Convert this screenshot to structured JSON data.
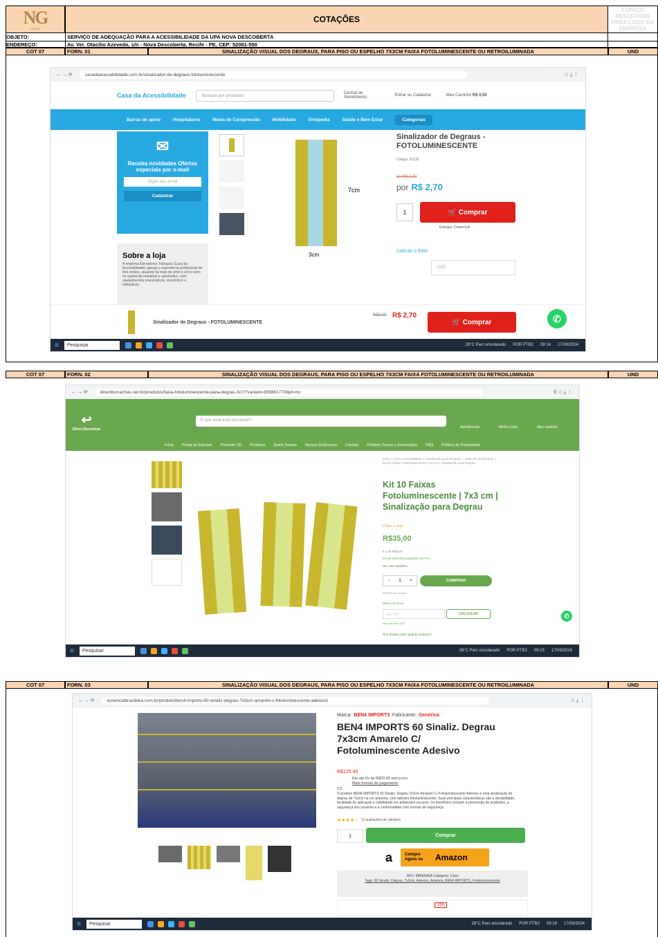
{
  "header": {
    "logo": "NG",
    "logo_sub": "FARMA",
    "title": "COTAÇÕES",
    "reserved": "ESPAÇO RESERVADO PARA LOGO DA EMPRESA"
  },
  "meta": {
    "objeto_label": "OBJETO:",
    "objeto": "SERVIÇO DE ADEQUAÇÃO PARA A ACESSIBILIDADE DA UPA NOVA DESCOBERTA",
    "endereco_label": "ENDEREÇO:",
    "endereco": "Av. Ver. Otacílio Azevedo, s/n - Nova Descoberta, Recife - PE, CEP: 52081-550"
  },
  "quotes": [
    {
      "cot": "COT 07",
      "forn": "FORN. 01",
      "item": "SINALIZAÇÃO VISUAL DOS DEGRAUS, PARA PISO OU ESPELHO 7X3CM FAIXA FOTOLUMINESCENTE OU RETROILUMINADA",
      "und": "UND"
    },
    {
      "cot": "COT 07",
      "forn": "FORN. 02",
      "item": "SINALIZAÇÃO VISUAL DOS DEGRAUS, PARA PISO OU ESPELHO 7X3CM FAIXA FOTOLUMINESCENTE OU RETROILUMINADA",
      "und": "UND"
    },
    {
      "cot": "COT 07",
      "forn": "FORN. 03",
      "item": "SINALIZAÇÃO VISUAL DOS DEGRAUS, PARA PISO OU ESPELHO 7X3CM FAIXA FOTOLUMINESCENTE OU RETROILUMINADA",
      "und": "UND"
    }
  ],
  "shot1": {
    "url": "casadaacessibilidade.com.br/sinalizador-de-degraus-fotoluminescente",
    "store": "Casa da Acessibilidade",
    "search": "Busque por produtos",
    "central": "Central de Atendimento",
    "entrar": "Entrar ou Cadastrar",
    "cart": "Meu Carrinho",
    "cart_val": "R$ 0,00",
    "nav": [
      "Barras de apoio",
      "Hospitalares",
      "Meias de Compressão",
      "Mobilidade",
      "Ortopedia",
      "Saúde e Bem Estar",
      "Categorias"
    ],
    "news_title": "Receba novidades Ofertas especiais por e-mail",
    "email_ph": "Digite seu email",
    "cadastrar": "Cadastrar",
    "sobre": "Sobre a loja",
    "sobre_text": "A empresa Elevadores Triângulo (Casa da Acessibilidade) agrega a experiência profissional de três irmãos, atuando há mais de vinte e cinco anos no segmento industrial e automotivo, com equipamentos pneumáticos, mecânicos e hidráulicos.",
    "dim_h": "7cm",
    "dim_w": "3cm",
    "product": "Sinalizador de Degraus - FOTOLUMINESCENTE",
    "codigo": "Código: 62135",
    "old": "de R$ 3,00",
    "por": "por",
    "price": "R$ 2,70",
    "qty": "1",
    "comprar": "Comprar",
    "estoque": "Estoque: Disponível",
    "frete": "Calcule o frete",
    "cep": "CEP",
    "bar_product": "Sinalizador de Degraus - FOTOLUMINESCENTE",
    "bar_old": "R$3,00",
    "bar_price": "R$ 2,70",
    "taskbar_search": "Pesquisar",
    "weather": "28°C Parc ensolarado",
    "lang": "POR PTB2",
    "time": "09:14",
    "date": "17/09/2024"
  },
  "shot2": {
    "url": "directborrachas.net.br/produtos/faixa-fotoluminescente-para-degrau-3x7/?variant=3558617708pf=mc",
    "search": "O que você está buscando?",
    "brand": "Direct Borrachas",
    "nav": [
      "Início",
      "Ponta de Estoque",
      "Premium 3D",
      "Produtos",
      "Quem Somos",
      "Nossos Endereços",
      "Contato",
      "Pedidos Trocas e Devoluções",
      "FAQ",
      "Política de Privacidade"
    ],
    "top_links": [
      "Atendimento",
      "Minha conta",
      "Meu carrinho"
    ],
    "breadcrumb": "Início > Linha Acessibilidade > Sinalização para Escadas > Faixa de Sinalização > Kit 10 Faixas Fotoluminescente | 7x3 cm | Sinalização para Degrau",
    "title": "Kit 10 Faixas Fotoluminescente | 7x3 cm | Sinalização para Degrau",
    "note": "Clique e veja!",
    "price": "R$35,00",
    "install": "8 x de R$5,09",
    "desconto": "5% de desconto pagando com Pix",
    "detalhes": "Ver mais detalhes",
    "qty": "1",
    "comprar": "COMPRAR",
    "estoque": "999999 em estoque",
    "frete": "Meios de envio",
    "cep_ph": "Seu CEP",
    "calcular": "CALCULAR",
    "naosei": "Não sei meu CEP",
    "duvida": "Tem dúvida sobre quanto comprar?",
    "taskbar_search": "Pesquisar",
    "weather": "28°C Parc ensolarado",
    "lang": "POR PTB2",
    "time": "09:15",
    "date": "17/09/2024"
  },
  "shot3": {
    "url": "essenciabrasileira.com.br/produto/ben4-imports-60-sinaliz-degrau-7x3cm-amarelo-c-fotoluminescente-adesivo/",
    "marca_label": "Marca:",
    "marca": "BEN4 IMPORTS",
    "fab_label": "Fabricante:",
    "fab": "Genérica",
    "title": "BEN4 IMPORTS 60 Sinaliz. Degrau 7x3cm Amarelo C/ Fotoluminescente Adesivo",
    "price": "R$125.40",
    "install": "Em até 6x de R$20.90 sem juros",
    "formas": "Mais formas de pagamento",
    "desc": "O produto BEN4 IMPORTS 60 Sinaliz. Degrau 7x3cm Amarelo C/ Fotoluminescente Adesivo é uma sinalização de degrau de 7x3cm na cor amarela, com adesivo fotoluminescente. Suas principais características são a durabilidade, facilidade de aplicação e visibilidade em ambientes escuros. Os benefícios incluem a prevenção de acidentes, a segurança dos usuários e a conformidade com normas de segurança.",
    "stars": "★★★★☆",
    "reviews": "(2 avaliações de clientes)",
    "qty": "1",
    "comprar": "Comprar",
    "amazon_a": "a",
    "amazon_compre": "Compre Agora na",
    "amazon": "Amazon",
    "sku": "SKU: 9B4E5A5A   Categoria: Casa",
    "tags": "Tags: 60 Sinaliz. Degrau, 7x3cm, Adesivo, Amarelo, BEN4 IMPORTS, Fotoluminescente",
    "discount": "-19%",
    "taskbar_search": "Pesquisar",
    "weather": "28°C Parc ensolarado",
    "lang": "POR PTB2",
    "time": "09:16",
    "date": "17/09/2024"
  },
  "colors": {
    "peach": "#fcd5b4",
    "casa_blue": "#29a9e1",
    "casa_red": "#e0201b",
    "green": "#6aa84f",
    "dark_green": "#4b8a3b",
    "amazon": "#f7a21b"
  }
}
